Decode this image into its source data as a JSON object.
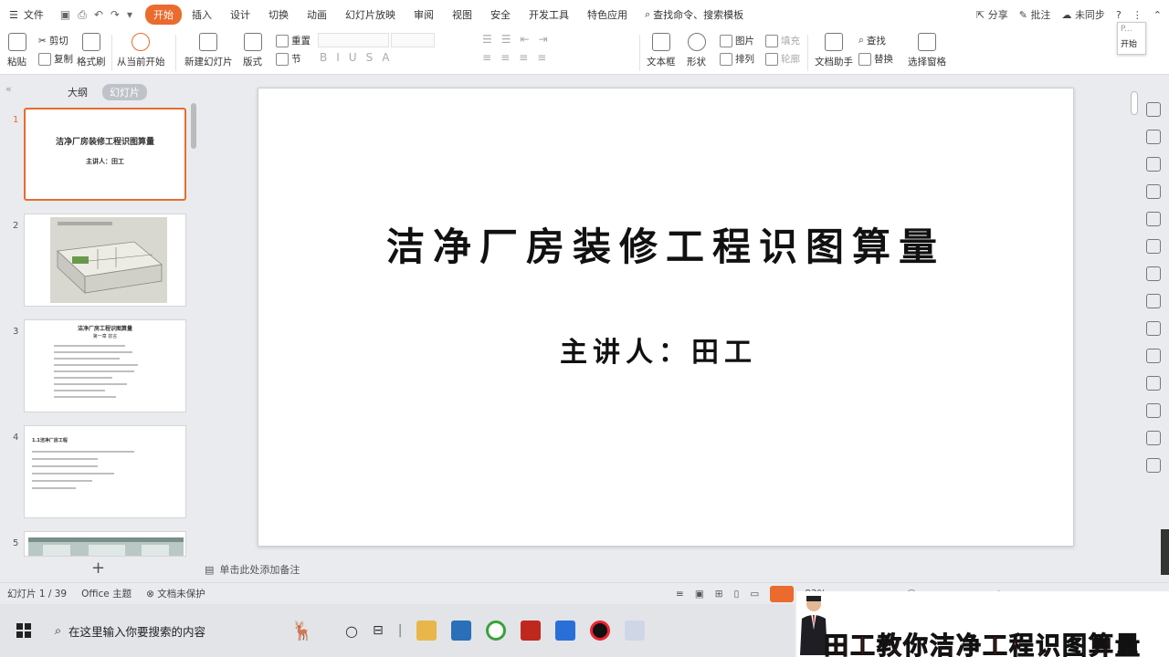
{
  "menubar": {
    "file_label": "文件",
    "tabs": [
      "开始",
      "插入",
      "设计",
      "切换",
      "动画",
      "幻灯片放映",
      "审阅",
      "视图",
      "安全",
      "开发工具",
      "特色应用"
    ],
    "search_label": "查找命令、搜索模板",
    "share": "分享",
    "comment": "批注",
    "sync": "未同步"
  },
  "ribbon": {
    "paste": "粘贴",
    "cut": "剪切",
    "copy": "复制",
    "format_painter": "格式刷",
    "from_current": "从当前开始",
    "new_slide": "新建幻灯片",
    "layout": "版式",
    "reset": "重置",
    "section": "节",
    "textbox": "文本框",
    "shape": "形状",
    "picture": "图片",
    "arrange": "排列",
    "fill": "填充",
    "outline": "轮廓",
    "doc_assistant": "文档助手",
    "find": "查找",
    "replace": "替换",
    "select_pane": "选择窗格",
    "start_popup_label": "开始",
    "start_popup_p": "P..."
  },
  "leftpane": {
    "outline_tab": "大纲",
    "slides_tab": "幻灯片",
    "thumbs": [
      {
        "num": "1",
        "title": "洁净厂房装修工程识图算量",
        "sub": "主讲人：田工"
      },
      {
        "num": "2"
      },
      {
        "num": "3",
        "title": "洁净厂房工程识图算量",
        "sub": "第一章  前言"
      },
      {
        "num": "4",
        "title": "1.1洁净厂房工程"
      },
      {
        "num": "5"
      }
    ]
  },
  "slide": {
    "title": "洁净厂房装修工程识图算量",
    "subtitle": "主讲人：田工"
  },
  "notes_placeholder": "单击此处添加备注",
  "statusbar": {
    "slide_counter": "幻灯片 1 / 39",
    "theme": "Office 主题",
    "protection": "文档未保护",
    "zoom": "83%"
  },
  "taskbar": {
    "search_placeholder": "在这里输入你要搜索的内容"
  },
  "banner": {
    "text": "田工教你洁净工程识图算量"
  },
  "colors": {
    "accent": "#ea6b2d",
    "banner_red": "#e8321e"
  }
}
